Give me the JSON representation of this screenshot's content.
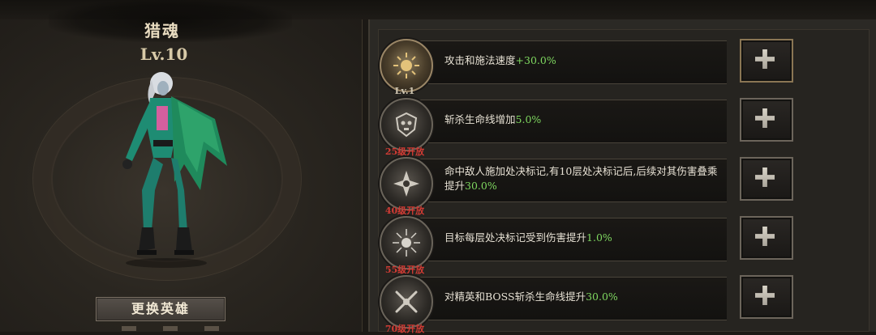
{
  "hero": {
    "name": "猎魂",
    "level": "Lv.10",
    "change_button_label": "更换英雄"
  },
  "skills": [
    {
      "icon": "sun-emblem-icon",
      "prefix": "攻击和施法速度",
      "value": "+30.0%",
      "suffix": "",
      "level_label": "Lv.1",
      "locked": false
    },
    {
      "icon": "skull-shield-icon",
      "prefix": "斩杀生命线增加",
      "value": "5.0%",
      "suffix": "",
      "level_label": "25级开放",
      "locked": true
    },
    {
      "icon": "spiked-star-icon",
      "prefix": "命中敌人施加处决标记,有10层处决标记后,后续对其伤害叠乘提升",
      "value": "30.0%",
      "suffix": "",
      "level_label": "40级开放",
      "locked": true
    },
    {
      "icon": "burst-icon",
      "prefix": "目标每层处决标记受到伤害提升",
      "value": "1.0%",
      "suffix": "",
      "level_label": "55级开放",
      "locked": true
    },
    {
      "icon": "crossed-blades-icon",
      "prefix": "对精英和BOSS斩杀生命线提升",
      "value": "30.0%",
      "suffix": "",
      "level_label": "70级开放",
      "locked": true
    }
  ],
  "colors": {
    "highlight_value": "#7fd860",
    "locked_label": "#d13b34",
    "hero_cape": "#1f8a5c"
  }
}
